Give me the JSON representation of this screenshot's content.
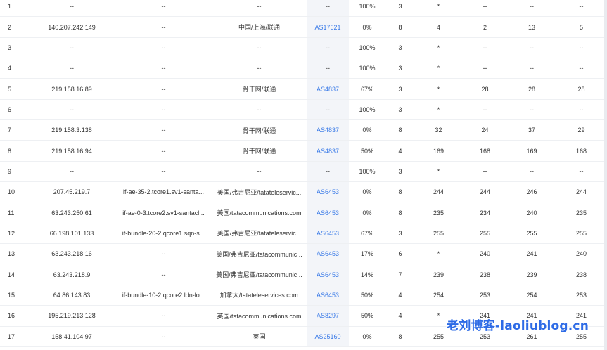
{
  "rows": [
    {
      "hop": "1",
      "ip": "--",
      "host": "--",
      "loc": "--",
      "asn": "--",
      "loss": "100%",
      "snt": "3",
      "last": "*",
      "avg": "--",
      "best": "--",
      "wrst": "--"
    },
    {
      "hop": "2",
      "ip": "140.207.242.149",
      "host": "--",
      "loc": "中国/上海/联通",
      "asn": "AS17621",
      "loss": "0%",
      "snt": "8",
      "last": "4",
      "avg": "2",
      "best": "13",
      "wrst": "5"
    },
    {
      "hop": "3",
      "ip": "--",
      "host": "--",
      "loc": "--",
      "asn": "--",
      "loss": "100%",
      "snt": "3",
      "last": "*",
      "avg": "--",
      "best": "--",
      "wrst": "--"
    },
    {
      "hop": "4",
      "ip": "--",
      "host": "--",
      "loc": "--",
      "asn": "--",
      "loss": "100%",
      "snt": "3",
      "last": "*",
      "avg": "--",
      "best": "--",
      "wrst": "--"
    },
    {
      "hop": "5",
      "ip": "219.158.16.89",
      "host": "--",
      "loc": "骨干网/联通",
      "asn": "AS4837",
      "loss": "67%",
      "snt": "3",
      "last": "*",
      "avg": "28",
      "best": "28",
      "wrst": "28"
    },
    {
      "hop": "6",
      "ip": "--",
      "host": "--",
      "loc": "--",
      "asn": "--",
      "loss": "100%",
      "snt": "3",
      "last": "*",
      "avg": "--",
      "best": "--",
      "wrst": "--"
    },
    {
      "hop": "7",
      "ip": "219.158.3.138",
      "host": "--",
      "loc": "骨干网/联通",
      "asn": "AS4837",
      "loss": "0%",
      "snt": "8",
      "last": "32",
      "avg": "24",
      "best": "37",
      "wrst": "29"
    },
    {
      "hop": "8",
      "ip": "219.158.16.94",
      "host": "--",
      "loc": "骨干网/联通",
      "asn": "AS4837",
      "loss": "50%",
      "snt": "4",
      "last": "169",
      "avg": "168",
      "best": "169",
      "wrst": "168"
    },
    {
      "hop": "9",
      "ip": "--",
      "host": "--",
      "loc": "--",
      "asn": "--",
      "loss": "100%",
      "snt": "3",
      "last": "*",
      "avg": "--",
      "best": "--",
      "wrst": "--"
    },
    {
      "hop": "10",
      "ip": "207.45.219.7",
      "host": "if-ae-35-2.tcore1.sv1-santa...",
      "loc": "美国/弗吉尼亚/tatateleservic...",
      "asn": "AS6453",
      "loss": "0%",
      "snt": "8",
      "last": "244",
      "avg": "244",
      "best": "246",
      "wrst": "244"
    },
    {
      "hop": "11",
      "ip": "63.243.250.61",
      "host": "if-ae-0-3.tcore2.sv1-santacl...",
      "loc": "美国/tatacommunications.com",
      "asn": "AS6453",
      "loss": "0%",
      "snt": "8",
      "last": "235",
      "avg": "234",
      "best": "240",
      "wrst": "235"
    },
    {
      "hop": "12",
      "ip": "66.198.101.133",
      "host": "if-bundle-20-2.qcore1.sqn-s...",
      "loc": "美国/弗吉尼亚/tatateleservic...",
      "asn": "AS6453",
      "loss": "67%",
      "snt": "3",
      "last": "255",
      "avg": "255",
      "best": "255",
      "wrst": "255"
    },
    {
      "hop": "13",
      "ip": "63.243.218.16",
      "host": "--",
      "loc": "美国/弗吉尼亚/tatacommunic...",
      "asn": "AS6453",
      "loss": "17%",
      "snt": "6",
      "last": "*",
      "avg": "240",
      "best": "241",
      "wrst": "240"
    },
    {
      "hop": "14",
      "ip": "63.243.218.9",
      "host": "--",
      "loc": "美国/弗吉尼亚/tatacommunic...",
      "asn": "AS6453",
      "loss": "14%",
      "snt": "7",
      "last": "239",
      "avg": "238",
      "best": "239",
      "wrst": "238"
    },
    {
      "hop": "15",
      "ip": "64.86.143.83",
      "host": "if-bundle-10-2.qcore2.ldn-lo...",
      "loc": "加拿大/tatateleservices.com",
      "asn": "AS6453",
      "loss": "50%",
      "snt": "4",
      "last": "254",
      "avg": "253",
      "best": "254",
      "wrst": "253"
    },
    {
      "hop": "16",
      "ip": "195.219.213.128",
      "host": "--",
      "loc": "英国/tatacommunications.com",
      "asn": "AS8297",
      "loss": "50%",
      "snt": "4",
      "last": "*",
      "avg": "241",
      "best": "241",
      "wrst": "241"
    },
    {
      "hop": "17",
      "ip": "158.41.104.97",
      "host": "--",
      "loc": "英国",
      "asn": "AS25160",
      "loss": "0%",
      "snt": "8",
      "last": "255",
      "avg": "253",
      "best": "261",
      "wrst": "255"
    }
  ],
  "watermark": "老刘博客-laoliublog.cn",
  "colors": {
    "link": "#3b7be8",
    "as_column_bg": "#f3f5f9",
    "row_border": "#eef0f3",
    "watermark": "#2e6be6"
  }
}
